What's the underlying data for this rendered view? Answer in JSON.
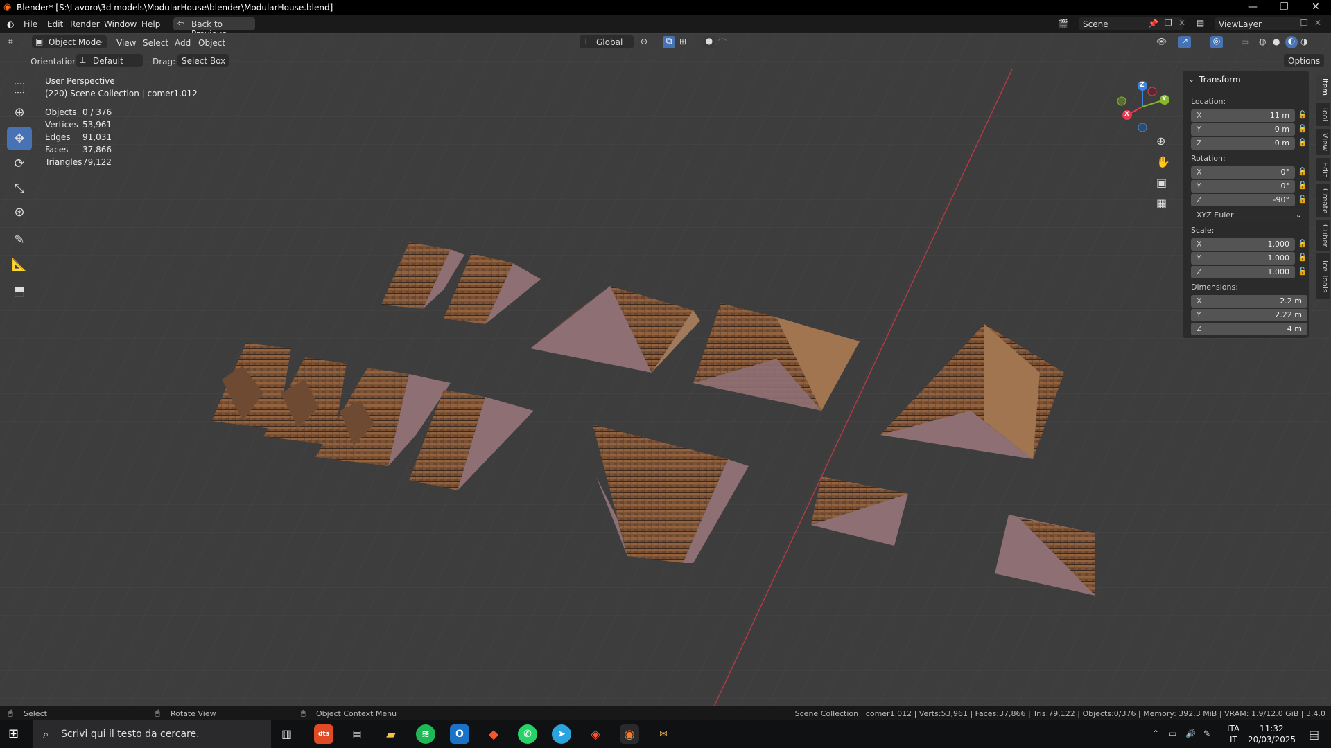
{
  "titlebar": {
    "title": "Blender* [S:\\Lavoro\\3d models\\ModularHouse\\blender\\ModularHouse.blend]"
  },
  "menu": {
    "file": "File",
    "edit": "Edit",
    "render": "Render",
    "window": "Window",
    "help": "Help",
    "back": "Back to Previous"
  },
  "scene": {
    "name": "Scene",
    "viewlayer": "ViewLayer"
  },
  "header": {
    "mode": "Object Mode",
    "view": "View",
    "select": "Select",
    "add": "Add",
    "object": "Object",
    "transform_space": "Global",
    "options": "Options"
  },
  "toolsettings": {
    "orientation_label": "Orientation:",
    "orientation_value": "Default",
    "drag_label": "Drag:",
    "drag_value": "Select Box"
  },
  "overlay": {
    "perspective": "User Perspective",
    "collection": "(220) Scene Collection | comer1.012",
    "stats": [
      {
        "label": "Objects",
        "value": "0 / 376"
      },
      {
        "label": "Vertices",
        "value": "53,961"
      },
      {
        "label": "Edges",
        "value": "91,031"
      },
      {
        "label": "Faces",
        "value": "37,866"
      },
      {
        "label": "Triangles",
        "value": "79,122"
      }
    ]
  },
  "gizmo": {
    "x": "X",
    "y": "Y",
    "z": "Z"
  },
  "npanel": {
    "title": "Transform",
    "location_label": "Location:",
    "location": [
      {
        "axis": "X",
        "value": "11 m"
      },
      {
        "axis": "Y",
        "value": "0 m"
      },
      {
        "axis": "Z",
        "value": "0 m"
      }
    ],
    "rotation_label": "Rotation:",
    "rotation": [
      {
        "axis": "X",
        "value": "0°"
      },
      {
        "axis": "Y",
        "value": "0°"
      },
      {
        "axis": "Z",
        "value": "-90°"
      }
    ],
    "rotation_mode": "XYZ Euler",
    "scale_label": "Scale:",
    "scale": [
      {
        "axis": "X",
        "value": "1.000"
      },
      {
        "axis": "Y",
        "value": "1.000"
      },
      {
        "axis": "Z",
        "value": "1.000"
      }
    ],
    "dimensions_label": "Dimensions:",
    "dimensions": [
      {
        "axis": "X",
        "value": "2.2 m"
      },
      {
        "axis": "Y",
        "value": "2.22 m"
      },
      {
        "axis": "Z",
        "value": "4 m"
      }
    ]
  },
  "sidetabs": [
    "Item",
    "Tool",
    "View",
    "Edit",
    "Create",
    "Cuber",
    "Ice Tools"
  ],
  "statusbar": {
    "select": "Select",
    "rotate": "Rotate View",
    "context": "Object Context Menu",
    "info": "Scene Collection | comer1.012 | Verts:53,961 | Faces:37,866 | Tris:79,122 | Objects:0/376 | Memory: 392.3 MiB | VRAM: 1.9/12.0 GiB | 3.4.0"
  },
  "taskbar": {
    "search": "Scrivi qui il testo da cercare.",
    "lang1": "ITA",
    "lang2": "IT",
    "time": "11:32",
    "date": "20/03/2025"
  },
  "colors": {
    "accent": "#4772b3",
    "viewport": "#3d3d3d",
    "x_axis": "#e83a4f",
    "y_axis": "#88b82f",
    "z_axis": "#3f84dc"
  }
}
